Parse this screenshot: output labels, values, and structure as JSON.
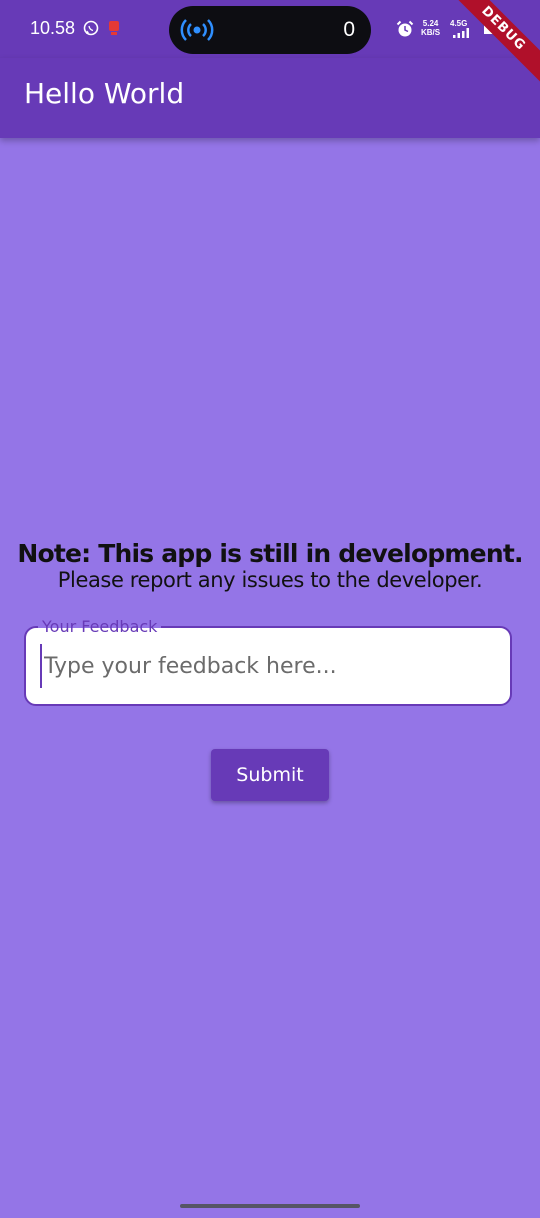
{
  "status_bar": {
    "time": "10.58",
    "island_count": "0",
    "net_speed_value": "5.24",
    "net_speed_unit": "KB/S",
    "net_type": "4.5G"
  },
  "debug_banner": "DEBUG",
  "app_bar": {
    "title": "Hello World"
  },
  "main": {
    "note_heading": "Note: This app is still in development.",
    "note_subtext": "Please report any issues to the developer."
  },
  "feedback": {
    "label": "Your Feedback",
    "placeholder": "Type your feedback here...",
    "value": ""
  },
  "submit_label": "Submit",
  "colors": {
    "primary": "#673ab7",
    "background": "#9475e7",
    "debug_banner": "#b0102a"
  },
  "icons": {
    "status": [
      "whatsapp-icon",
      "notification-icon",
      "broadcast-icon",
      "alarm-icon",
      "signal-icon",
      "battery-icon"
    ]
  }
}
